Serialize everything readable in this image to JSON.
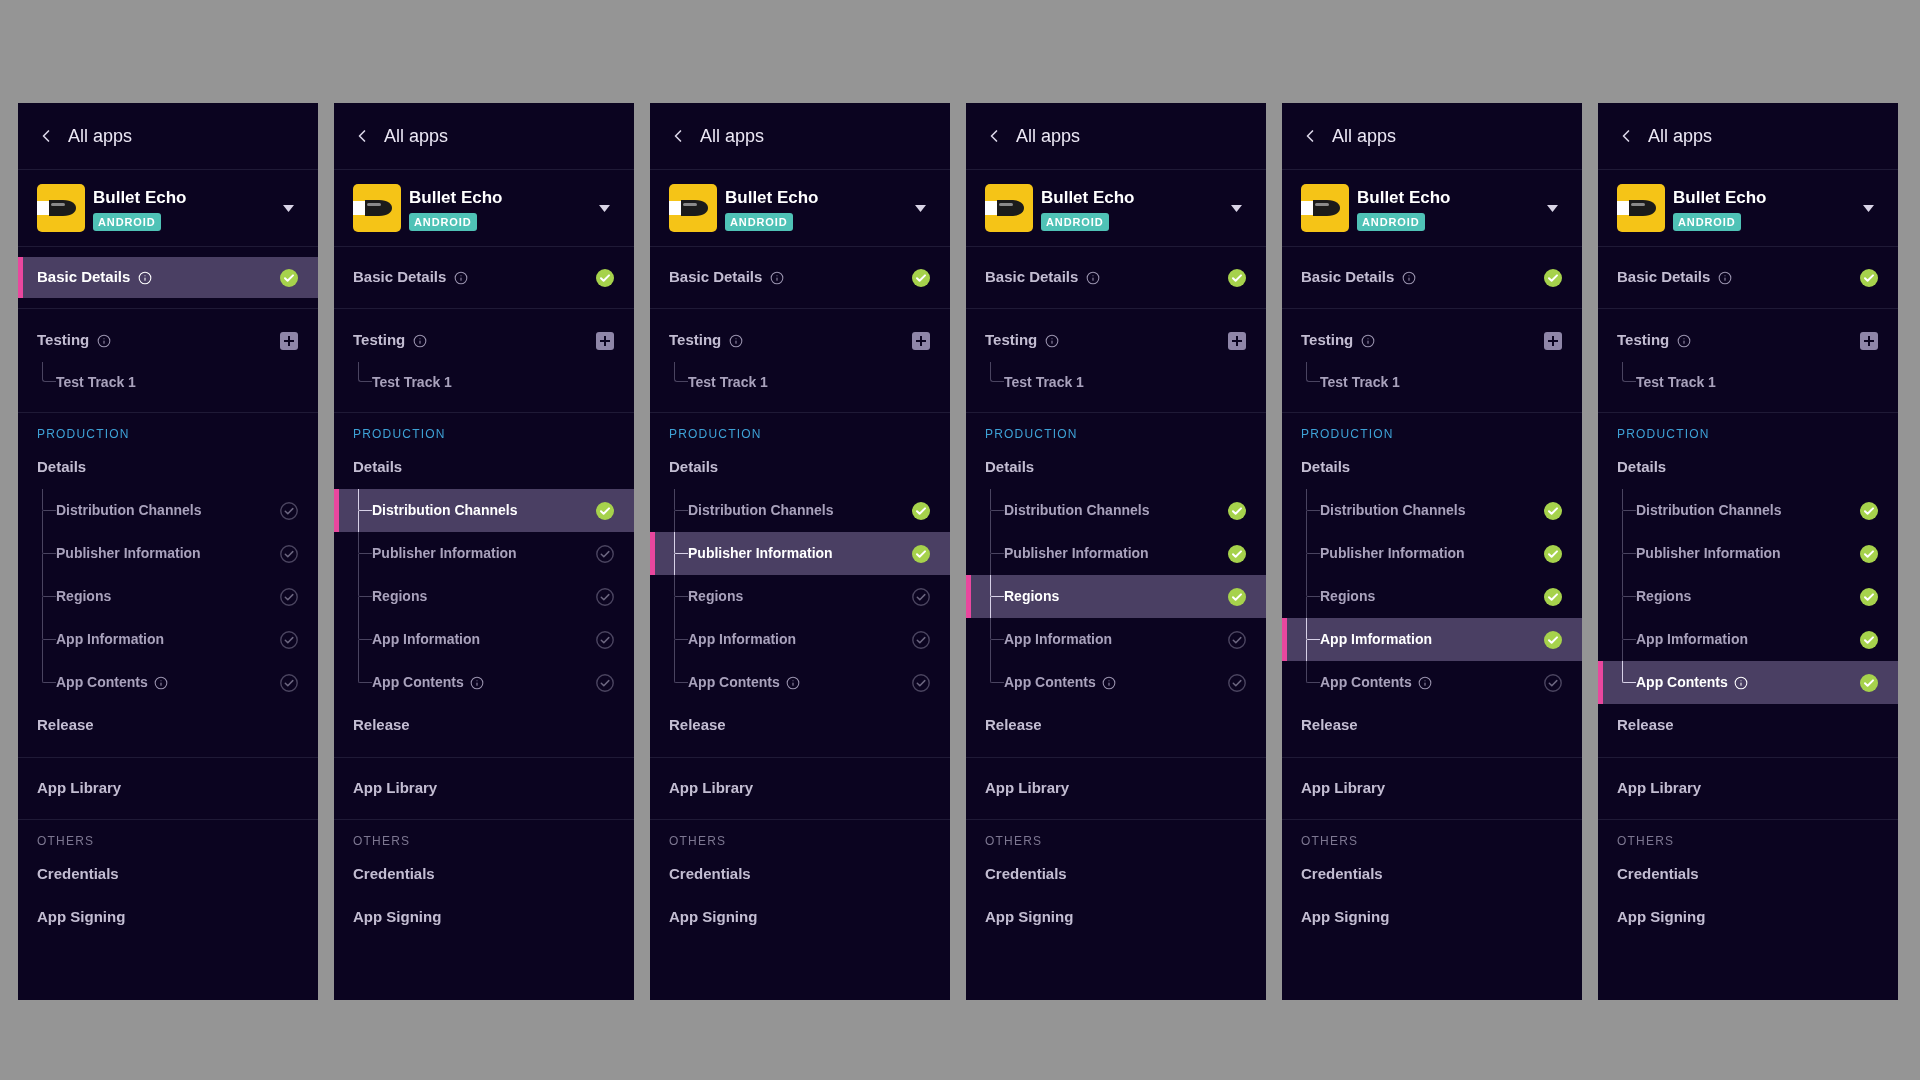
{
  "panels": [
    {
      "back_label": "All apps",
      "app": {
        "name": "Bullet Echo",
        "platform": "ANDROID"
      },
      "basic_details": {
        "label": "Basic Details",
        "info": true,
        "selected": true,
        "done": true
      },
      "testing": {
        "label": "Testing",
        "info": true,
        "tracks": [
          {
            "label": "Test Track 1",
            "selected": false
          }
        ]
      },
      "production": {
        "heading": "PRODUCTION",
        "details": {
          "label": "Details",
          "selected": false,
          "children": [
            {
              "label": "Distribution Channels",
              "info": false,
              "done": false,
              "selected": false
            },
            {
              "label": "Publisher Information",
              "info": false,
              "done": false,
              "selected": false
            },
            {
              "label": "Regions",
              "info": false,
              "done": false,
              "selected": false
            },
            {
              "label": "App Information",
              "info": false,
              "done": false,
              "selected": false
            },
            {
              "label": "App Contents",
              "info": true,
              "done": false,
              "selected": false
            }
          ]
        },
        "release": {
          "label": "Release",
          "selected": false
        }
      },
      "app_library": {
        "label": "App Library",
        "selected": false
      },
      "others": {
        "heading": "OTHERS",
        "items": [
          {
            "label": "Credentials",
            "selected": false
          },
          {
            "label": "App Signing",
            "selected": false
          }
        ]
      }
    },
    {
      "back_label": "All apps",
      "app": {
        "name": "Bullet Echo",
        "platform": "ANDROID"
      },
      "basic_details": {
        "label": "Basic Details",
        "info": true,
        "selected": false,
        "done": true
      },
      "testing": {
        "label": "Testing",
        "info": true,
        "tracks": [
          {
            "label": "Test Track 1",
            "selected": false
          }
        ]
      },
      "production": {
        "heading": "PRODUCTION",
        "details": {
          "label": "Details",
          "selected": false,
          "children": [
            {
              "label": "Distribution Channels",
              "info": false,
              "done": true,
              "selected": true
            },
            {
              "label": "Publisher Information",
              "info": false,
              "done": false,
              "selected": false
            },
            {
              "label": "Regions",
              "info": false,
              "done": false,
              "selected": false
            },
            {
              "label": "App Information",
              "info": false,
              "done": false,
              "selected": false
            },
            {
              "label": "App Contents",
              "info": true,
              "done": false,
              "selected": false
            }
          ]
        },
        "release": {
          "label": "Release",
          "selected": false
        }
      },
      "app_library": {
        "label": "App Library",
        "selected": false
      },
      "others": {
        "heading": "OTHERS",
        "items": [
          {
            "label": "Credentials",
            "selected": false
          },
          {
            "label": "App Signing",
            "selected": false
          }
        ]
      }
    },
    {
      "back_label": "All apps",
      "app": {
        "name": "Bullet Echo",
        "platform": "ANDROID"
      },
      "basic_details": {
        "label": "Basic Details",
        "info": true,
        "selected": false,
        "done": true
      },
      "testing": {
        "label": "Testing",
        "info": true,
        "tracks": [
          {
            "label": "Test Track 1",
            "selected": false
          }
        ]
      },
      "production": {
        "heading": "PRODUCTION",
        "details": {
          "label": "Details",
          "selected": false,
          "children": [
            {
              "label": "Distribution Channels",
              "info": false,
              "done": true,
              "selected": false
            },
            {
              "label": "Publisher Information",
              "info": false,
              "done": true,
              "selected": true
            },
            {
              "label": "Regions",
              "info": false,
              "done": false,
              "selected": false
            },
            {
              "label": "App Information",
              "info": false,
              "done": false,
              "selected": false
            },
            {
              "label": "App Contents",
              "info": true,
              "done": false,
              "selected": false
            }
          ]
        },
        "release": {
          "label": "Release",
          "selected": false
        }
      },
      "app_library": {
        "label": "App Library",
        "selected": false
      },
      "others": {
        "heading": "OTHERS",
        "items": [
          {
            "label": "Credentials",
            "selected": false
          },
          {
            "label": "App Signing",
            "selected": false
          }
        ]
      }
    },
    {
      "back_label": "All apps",
      "app": {
        "name": "Bullet Echo",
        "platform": "ANDROID"
      },
      "basic_details": {
        "label": "Basic Details",
        "info": true,
        "selected": false,
        "done": true
      },
      "testing": {
        "label": "Testing",
        "info": true,
        "tracks": [
          {
            "label": "Test Track 1",
            "selected": false
          }
        ]
      },
      "production": {
        "heading": "PRODUCTION",
        "details": {
          "label": "Details",
          "selected": false,
          "children": [
            {
              "label": "Distribution Channels",
              "info": false,
              "done": true,
              "selected": false
            },
            {
              "label": "Publisher Information",
              "info": false,
              "done": true,
              "selected": false
            },
            {
              "label": "Regions",
              "info": false,
              "done": true,
              "selected": true
            },
            {
              "label": "App Information",
              "info": false,
              "done": false,
              "selected": false
            },
            {
              "label": "App Contents",
              "info": true,
              "done": false,
              "selected": false
            }
          ]
        },
        "release": {
          "label": "Release",
          "selected": false
        }
      },
      "app_library": {
        "label": "App Library",
        "selected": false
      },
      "others": {
        "heading": "OTHERS",
        "items": [
          {
            "label": "Credentials",
            "selected": false
          },
          {
            "label": "App Signing",
            "selected": false
          }
        ]
      }
    },
    {
      "back_label": "All apps",
      "app": {
        "name": "Bullet Echo",
        "platform": "ANDROID"
      },
      "basic_details": {
        "label": "Basic Details",
        "info": true,
        "selected": false,
        "done": true
      },
      "testing": {
        "label": "Testing",
        "info": true,
        "tracks": [
          {
            "label": "Test Track 1",
            "selected": false
          }
        ]
      },
      "production": {
        "heading": "PRODUCTION",
        "details": {
          "label": "Details",
          "selected": false,
          "children": [
            {
              "label": "Distribution Channels",
              "info": false,
              "done": true,
              "selected": false
            },
            {
              "label": "Publisher Information",
              "info": false,
              "done": true,
              "selected": false
            },
            {
              "label": "Regions",
              "info": false,
              "done": true,
              "selected": false
            },
            {
              "label": "App Imformation",
              "info": false,
              "done": true,
              "selected": true
            },
            {
              "label": "App Contents",
              "info": true,
              "done": false,
              "selected": false
            }
          ]
        },
        "release": {
          "label": "Release",
          "selected": false
        }
      },
      "app_library": {
        "label": "App Library",
        "selected": false
      },
      "others": {
        "heading": "OTHERS",
        "items": [
          {
            "label": "Credentials",
            "selected": false
          },
          {
            "label": "App Signing",
            "selected": false
          }
        ]
      }
    },
    {
      "back_label": "All apps",
      "app": {
        "name": "Bullet Echo",
        "platform": "ANDROID"
      },
      "basic_details": {
        "label": "Basic Details",
        "info": true,
        "selected": false,
        "done": true
      },
      "testing": {
        "label": "Testing",
        "info": true,
        "tracks": [
          {
            "label": "Test Track 1",
            "selected": false
          }
        ]
      },
      "production": {
        "heading": "PRODUCTION",
        "details": {
          "label": "Details",
          "selected": false,
          "children": [
            {
              "label": "Distribution Channels",
              "info": false,
              "done": true,
              "selected": false
            },
            {
              "label": "Publisher Information",
              "info": false,
              "done": true,
              "selected": false
            },
            {
              "label": "Regions",
              "info": false,
              "done": true,
              "selected": false
            },
            {
              "label": "App Imformation",
              "info": false,
              "done": true,
              "selected": false
            },
            {
              "label": "App Contents",
              "info": true,
              "done": true,
              "selected": true
            }
          ]
        },
        "release": {
          "label": "Release",
          "selected": false
        }
      },
      "app_library": {
        "label": "App Library",
        "selected": false
      },
      "others": {
        "heading": "OTHERS",
        "items": [
          {
            "label": "Credentials",
            "selected": false
          },
          {
            "label": "App Signing",
            "selected": false
          }
        ]
      }
    }
  ]
}
